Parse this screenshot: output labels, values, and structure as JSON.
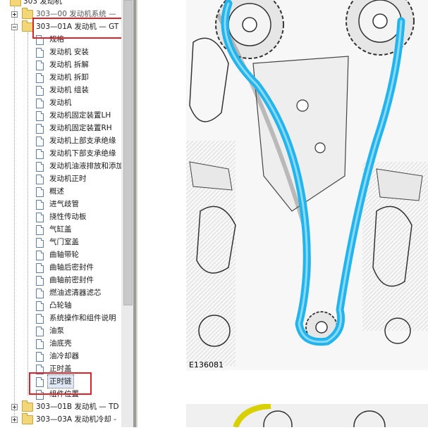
{
  "tree": {
    "root": "303 发动机",
    "sections": [
      {
        "label": "303—00 发动机系统 — ",
        "expanded": false
      },
      {
        "label": "303—01A 发动机 — GT",
        "expanded": true
      },
      {
        "label": "303—01B 发动机 — TD",
        "expanded": false
      },
      {
        "label": "303—03A 发动机冷却 -",
        "expanded": false
      }
    ],
    "items": [
      "规格",
      "发动机 安装",
      "发动机 拆解",
      "发动机 拆卸",
      "发动机 组装",
      "发动机",
      "发动机固定装置LH",
      "发动机固定装置RH",
      "发动机上部支承绝缘 ",
      "发动机下部支承绝缘 ",
      "发动机油液排放和添加",
      "发动机正时",
      "概述",
      "进气歧管",
      "挠性传动板",
      "气缸盖",
      "气门室盖",
      "曲轴带轮",
      "曲轴后密封件",
      "曲轴前密封件",
      "燃油滤清器滤芯",
      "凸轮轴",
      "系统操作和组件说明",
      "油泵",
      "油底壳",
      "油冷却器",
      "正时盖",
      "正时链",
      "组件位置"
    ],
    "selected_item": "正时链"
  },
  "figure": {
    "label": "E136081"
  },
  "colors": {
    "highlight_box": "#e2202a",
    "chain": "#22b4ec"
  }
}
